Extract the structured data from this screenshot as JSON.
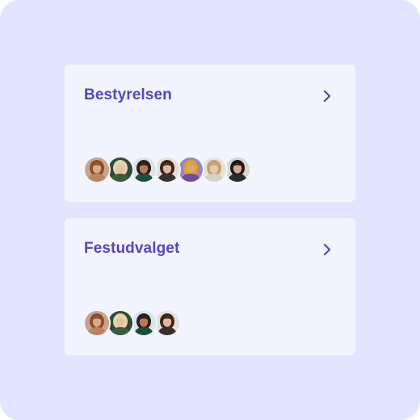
{
  "groups": [
    {
      "title": "Bestyrelsen",
      "chevron_icon": "chevron-right-icon",
      "accent": "#5b3fd6",
      "members": [
        {
          "bg": "#c9a48a",
          "skin": "#d9a98a",
          "hair": "#8a4e2c",
          "shirt": "#b88560"
        },
        {
          "bg": "#2f4a3a",
          "skin": "#e3c3a6",
          "hair": "#e8d2a8",
          "shirt": "#3e5a3c"
        },
        {
          "bg": "#d6e6ea",
          "skin": "#b67a58",
          "hair": "#2a1e18",
          "shirt": "#1e4d3a"
        },
        {
          "bg": "#e7ded6",
          "skin": "#e1b79c",
          "hair": "#3a2618",
          "shirt": "#3a3030"
        },
        {
          "bg": "#9b83c9",
          "skin": "#d8a585",
          "hair": "#e7a21c",
          "shirt": "#6b4d9c"
        },
        {
          "bg": "#e4e2dc",
          "skin": "#e8c8b0",
          "hair": "#c7a06a",
          "shirt": "#d8d2c6"
        },
        {
          "bg": "#d6d6d0",
          "skin": "#d6a88e",
          "hair": "#1c1614",
          "shirt": "#2a2a2a"
        }
      ]
    },
    {
      "title": "Festudvalget",
      "chevron_icon": "chevron-right-icon",
      "accent": "#5b3fd6",
      "members": [
        {
          "bg": "#c9a48a",
          "skin": "#d9a98a",
          "hair": "#8a4e2c",
          "shirt": "#b88560"
        },
        {
          "bg": "#2f4a3a",
          "skin": "#e3c3a6",
          "hair": "#e8d2a8",
          "shirt": "#3e5a3c"
        },
        {
          "bg": "#d6e6ea",
          "skin": "#b67a58",
          "hair": "#2a1e18",
          "shirt": "#1e4d3a"
        },
        {
          "bg": "#e7ded6",
          "skin": "#e1b79c",
          "hair": "#3a2618",
          "shirt": "#3a3030"
        }
      ]
    }
  ]
}
